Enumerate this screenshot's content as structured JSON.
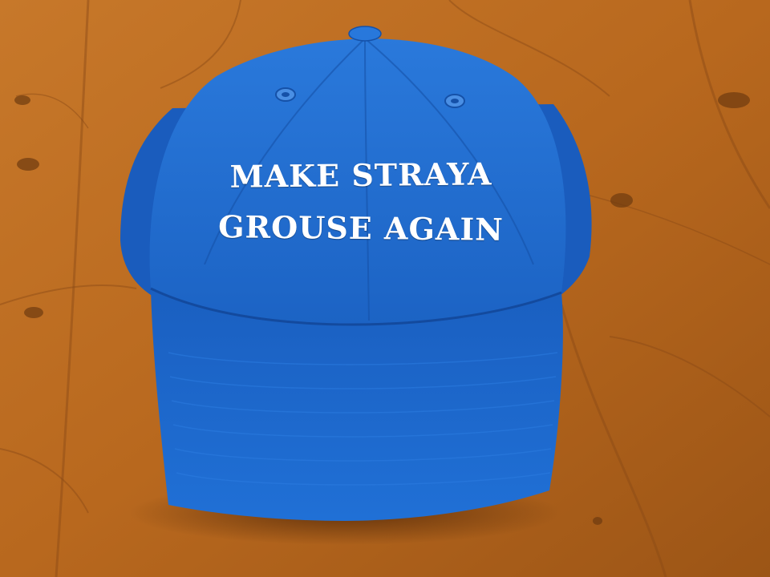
{
  "cap": {
    "line1": "MAKE STRAYA",
    "line2": "GROUSE AGAIN"
  },
  "colors": {
    "cap_blue": "#1f6fd4",
    "cap_shadow": "#1550a8",
    "embroidery": "#ffffff",
    "table_wood": "#c7782a",
    "wood_dark": "#8a4a16"
  }
}
